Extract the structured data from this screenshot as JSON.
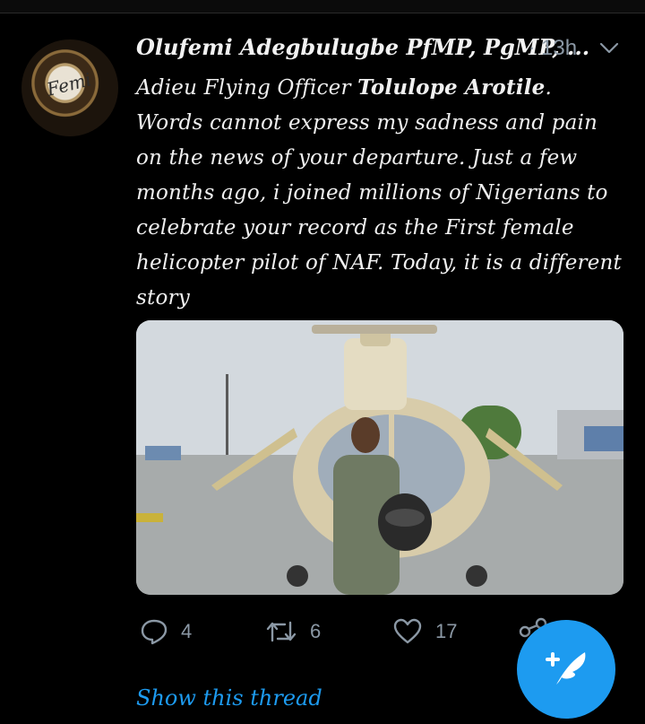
{
  "tweet": {
    "author": "Olufemi Adegbulugbe PfMP, PgMP, ...",
    "separator": "·",
    "time": "13h",
    "line1_prefix": "Adieu Flying Officer ",
    "line1_name": "Tolulope Arotile",
    "line1_suffix": ".",
    "text_rest": "Words cannot express my sadness and pain on the news of your departure. Just a few months ago, i joined millions of Nigerians to celebrate your record as the First female helicopter pilot of NAF. Today, it is a different story",
    "avatar_text": "Femi"
  },
  "actions": {
    "reply_count": "4",
    "retweet_count": "6",
    "like_count": "17"
  },
  "show_thread": "Show this thread",
  "icons": [
    "chevron-down-icon",
    "reply-icon",
    "retweet-icon",
    "like-icon",
    "share-icon",
    "compose-icon"
  ],
  "colors": {
    "accent": "#1d9bf0",
    "muted": "#8b98a5",
    "background": "#000000"
  }
}
